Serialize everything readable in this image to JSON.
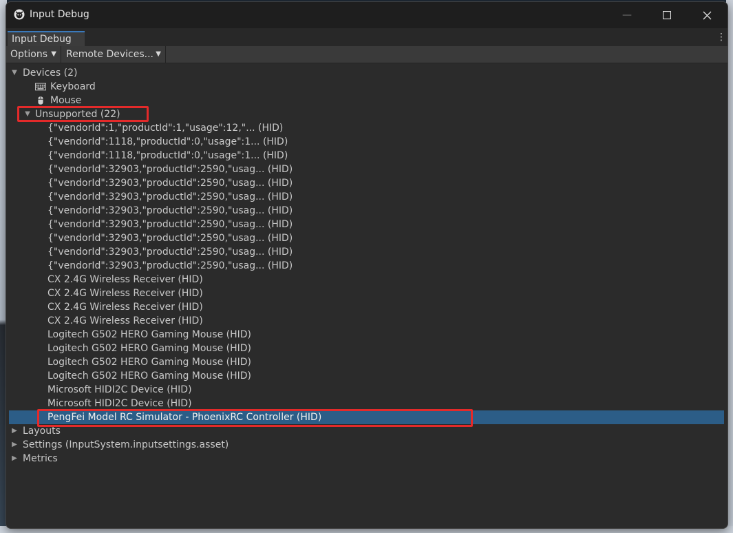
{
  "window": {
    "title": "Input Debug",
    "minimize_glyph": "—",
    "maximize_glyph": "☐",
    "close_glyph": "✕"
  },
  "tab": {
    "label": "Input Debug",
    "menu_glyph": "⋮"
  },
  "toolbar": {
    "options_label": "Options",
    "remote_label": "Remote Devices...",
    "caret": "▼"
  },
  "tree": {
    "devices": {
      "label": "Devices (2)",
      "children": [
        {
          "label": "Keyboard",
          "icon": "keyboard-icon"
        },
        {
          "label": "Mouse",
          "icon": "mouse-icon"
        }
      ]
    },
    "unsupported": {
      "label": "Unsupported (22)",
      "items": [
        "{\"vendorId\":1,\"productId\":1,\"usage\":12,\"... (HID)",
        "{\"vendorId\":1118,\"productId\":0,\"usage\":1... (HID)",
        "{\"vendorId\":1118,\"productId\":0,\"usage\":1... (HID)",
        "{\"vendorId\":32903,\"productId\":2590,\"usag... (HID)",
        "{\"vendorId\":32903,\"productId\":2590,\"usag... (HID)",
        "{\"vendorId\":32903,\"productId\":2590,\"usag... (HID)",
        "{\"vendorId\":32903,\"productId\":2590,\"usag... (HID)",
        "{\"vendorId\":32903,\"productId\":2590,\"usag... (HID)",
        "{\"vendorId\":32903,\"productId\":2590,\"usag... (HID)",
        "{\"vendorId\":32903,\"productId\":2590,\"usag... (HID)",
        "{\"vendorId\":32903,\"productId\":2590,\"usag... (HID)",
        "CX 2.4G Wireless Receiver (HID)",
        "CX 2.4G Wireless Receiver (HID)",
        "CX 2.4G Wireless Receiver (HID)",
        "CX 2.4G Wireless Receiver (HID)",
        "Logitech G502 HERO Gaming Mouse (HID)",
        "Logitech G502 HERO Gaming Mouse (HID)",
        "Logitech G502 HERO Gaming Mouse (HID)",
        "Logitech G502 HERO Gaming Mouse (HID)",
        "Microsoft HIDI2C Device (HID)",
        "Microsoft HIDI2C Device (HID)",
        "PengFei Model RC Simulator - PhoenixRC Controller (HID)"
      ],
      "selected_index": 21
    },
    "layouts": {
      "label": "Layouts"
    },
    "settings": {
      "label": "Settings (InputSystem.inputsettings.asset)"
    },
    "metrics": {
      "label": "Metrics"
    }
  },
  "colors": {
    "selection": "#2c5d87",
    "annotation_box": "#e32a2a",
    "tab_accent": "#3a79bb"
  }
}
